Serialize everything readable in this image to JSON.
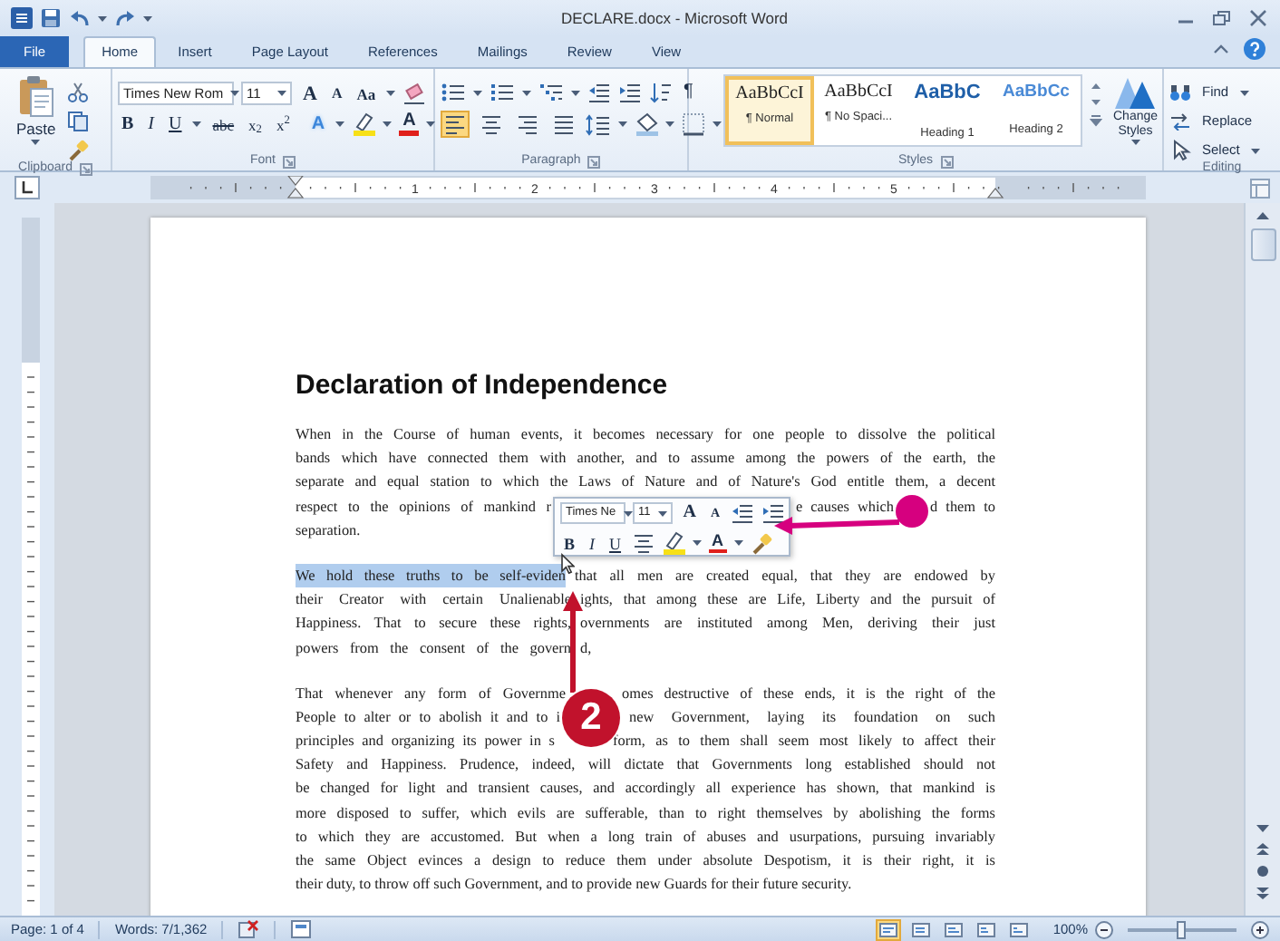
{
  "window": {
    "title": "DECLARE.docx - Microsoft Word"
  },
  "tabs": [
    {
      "label": "File",
      "kind": "file",
      "selected": false
    },
    {
      "label": "Home",
      "kind": "tab",
      "selected": true
    },
    {
      "label": "Insert",
      "kind": "tab",
      "selected": false
    },
    {
      "label": "Page Layout",
      "kind": "tab",
      "selected": false
    },
    {
      "label": "References",
      "kind": "tab",
      "selected": false
    },
    {
      "label": "Mailings",
      "kind": "tab",
      "selected": false
    },
    {
      "label": "Review",
      "kind": "tab",
      "selected": false
    },
    {
      "label": "View",
      "kind": "tab",
      "selected": false
    }
  ],
  "ribbon": {
    "clipboard": {
      "paste": "Paste",
      "label": "Clipboard"
    },
    "font": {
      "name": "Times New Rom",
      "size": "11",
      "grow": "A",
      "shrink": "A",
      "change_case": "Aa",
      "bold": "B",
      "italic": "I",
      "underline": "U",
      "strikethrough": "abc",
      "subscript": "x$_{2}$",
      "superscript": "x$^{2}$",
      "text_effects": "A",
      "font_color": "A",
      "label": "Font"
    },
    "paragraph": {
      "show_marks": "¶",
      "alignments": [
        {
          "selected": true
        },
        {
          "selected": false
        },
        {
          "selected": false
        },
        {
          "selected": false
        }
      ],
      "label": "Paragraph"
    },
    "styles": {
      "items": [
        {
          "sample": "AaBbCcI",
          "name": "¶ Normal",
          "kind": "body",
          "selected": true
        },
        {
          "sample": "AaBbCcI",
          "name": "¶ No Spaci...",
          "kind": "body",
          "selected": false
        },
        {
          "sample": "AaBbC",
          "name": "Heading 1",
          "kind": "heading1",
          "selected": false
        },
        {
          "sample": "AaBbCc",
          "name": "Heading 2",
          "kind": "heading2",
          "selected": false
        }
      ],
      "change_styles": "Change Styles",
      "label": "Styles"
    },
    "editing": {
      "find": "Find",
      "replace": "Replace",
      "select": "Select",
      "label": "Editing"
    }
  },
  "ruler": {
    "numbers": [
      "1",
      "2",
      "3",
      "4",
      "5"
    ]
  },
  "document": {
    "heading": "Declaration of Independence",
    "paragraphs": [
      [
        [
          {
            "text": "When in the Course of human events, it becomes necessary for one people to dissolve the political",
            "selected": false
          }
        ],
        [
          {
            "text": "bands which have connected them with another, and to assume among the powers of the earth, the",
            "selected": false
          }
        ],
        [
          {
            "text": "separate and equal station to which the Laws of Nature and of Nature's God entitle them, a decent",
            "selected": false
          }
        ],
        [
          {
            "text": "respect to the opinions of mankind r",
            "selected": false
          },
          {
            "text": "e causes which",
            "selected": false
          },
          {
            "text": "d them to",
            "selected": false
          }
        ],
        [
          {
            "text": "separation.",
            "selected": false
          }
        ]
      ],
      [
        [
          {
            "text": "We hold these truths to be self-eviden",
            "selected": true
          },
          {
            "text": "that all men are created equal, that they are endowed by",
            "selected": false
          }
        ],
        [
          {
            "text": "their Creator with certain Unalienable",
            "selected": false
          },
          {
            "text": "ights, that among these are Life, Liberty and the pursuit of",
            "selected": false
          }
        ],
        [
          {
            "text": "Happiness. That to secure these rights,",
            "selected": false
          },
          {
            "text": "overnments are instituted among Men, deriving their just",
            "selected": false
          }
        ],
        [
          {
            "text": "powers from the consent of the govern",
            "selected": false
          },
          {
            "text": "d,",
            "selected": false
          }
        ]
      ],
      [
        [
          {
            "text": "That whenever any form of Governme",
            "selected": false
          },
          {
            "text": "omes destructive of these ends, it is the right of the",
            "selected": false
          }
        ],
        [
          {
            "text": "People to alter or to abolish it and to i",
            "selected": false
          },
          {
            "text": "new Government, laying its foundation on such",
            "selected": false
          }
        ],
        [
          {
            "text": "principles and organizing its power in s",
            "selected": false
          },
          {
            "text": "form, as to them shall seem most likely to affect their",
            "selected": false
          }
        ],
        [
          {
            "text": "Safety and Happiness. Prudence, indeed, will dictate that Governments long established should not",
            "selected": false
          }
        ],
        [
          {
            "text": "be changed for light and transient causes, and accordingly all experience has shown, that mankind is",
            "selected": false
          }
        ],
        [
          {
            "text": "more disposed to suffer, which evils are sufferable, than to right themselves by abolishing the forms",
            "selected": false
          }
        ],
        [
          {
            "text": "to which they are accustomed. But when a long train of abuses and usurpations, pursuing invariably",
            "selected": false
          }
        ],
        [
          {
            "text": "the same Object evinces a design to reduce them under absolute Despotism, it is their right, it is",
            "selected": false
          }
        ],
        [
          {
            "text": "their duty, to throw off such Government, and to provide new Guards for their future security.",
            "selected": false
          }
        ]
      ]
    ]
  },
  "mini_toolbar": {
    "font": "Times Ne",
    "size": "11",
    "grow": "A",
    "shrink": "A",
    "bold": "B",
    "italic": "I",
    "underline": "U",
    "font_color": "A"
  },
  "callout": {
    "number": "2"
  },
  "status_bar": {
    "page": "Page: 1 of 4",
    "words": "Words: 7/1,362",
    "views": [
      {
        "selected": true
      },
      {
        "selected": false
      },
      {
        "selected": false
      },
      {
        "selected": false
      },
      {
        "selected": false
      }
    ],
    "zoom": "100%",
    "zoom_slider": {
      "level": 0.5
    }
  }
}
